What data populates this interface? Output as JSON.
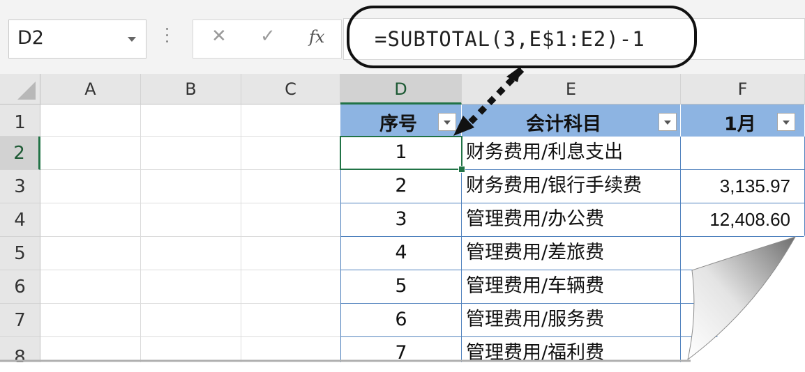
{
  "formula_bar": {
    "name_box": "D2",
    "cancel_glyph": "✕",
    "enter_glyph": "✓",
    "fx_glyph": "fx",
    "formula": "=SUBTOTAL(3,E$1:E2)-1"
  },
  "columns": [
    "A",
    "B",
    "C",
    "D",
    "E",
    "F"
  ],
  "rows": [
    "1",
    "2",
    "3",
    "4",
    "5",
    "6",
    "7",
    "8"
  ],
  "table": {
    "headers": {
      "seq": "序号",
      "account": "会计科目",
      "month": "1月"
    },
    "body": [
      {
        "seq": "1",
        "account": "财务费用/利息支出",
        "month": ""
      },
      {
        "seq": "2",
        "account": "财务费用/银行手续费",
        "month": "3,135.97"
      },
      {
        "seq": "3",
        "account": "管理费用/办公费",
        "month": "12,408.60"
      },
      {
        "seq": "4",
        "account": "管理费用/差旅费",
        "month": ""
      },
      {
        "seq": "5",
        "account": "管理费用/车辆费",
        "month": ""
      },
      {
        "seq": "6",
        "account": "管理费用/服务费",
        "month": ""
      },
      {
        "seq": "7",
        "account": "管理费用/福利费",
        "month": ""
      }
    ]
  },
  "colors": {
    "header_fill": "#8db4e2",
    "table_border": "#4f81bd",
    "selection": "#217346"
  },
  "icons": [
    "dropdown-arrow-icon",
    "cancel-icon",
    "enter-icon",
    "function-icon",
    "filter-icon",
    "select-all-icon"
  ]
}
